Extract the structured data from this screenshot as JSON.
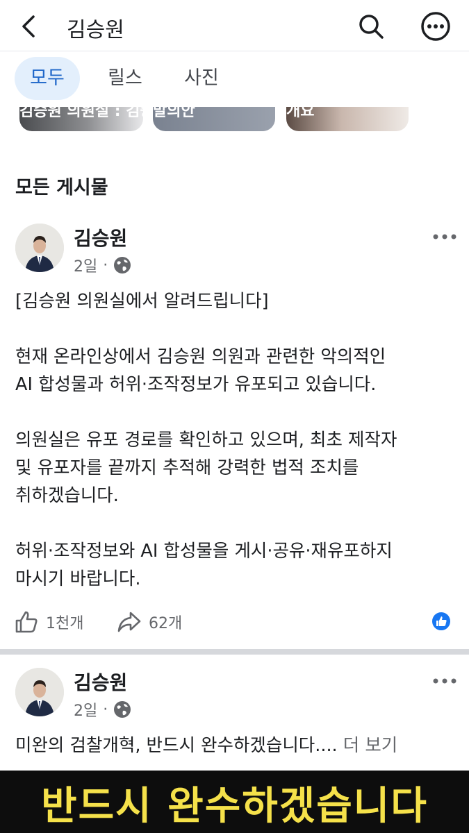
{
  "header": {
    "title": "김승원"
  },
  "tabs": [
    {
      "label": "모두",
      "active": true
    },
    {
      "label": "릴스",
      "active": false
    },
    {
      "label": "사진",
      "active": false
    }
  ],
  "thumbnails": [
    {
      "caption": "김승원 의원실 : 김승"
    },
    {
      "caption": "발의안"
    },
    {
      "caption": "개요"
    }
  ],
  "section": {
    "title": "모든 게시물"
  },
  "posts": [
    {
      "author": "김승원",
      "time": "2일",
      "separator": "·",
      "paragraphs": [
        "[김승원 의원실에서 알려드립니다]",
        "현재 온라인상에서 김승원 의원과 관련한 악의적인\nAI 합성물과 허위·조작정보가 유포되고 있습니다.",
        "의원실은 유포 경로를 확인하고 있으며, 최초 제작자\n및 유포자를 끝까지 추적해 강력한 법적 조치를\n취하겠습니다.",
        "허위·조작정보와 AI 합성물을 게시·공유·재유포하지\n마시기 바랍니다."
      ],
      "likes": "1천개",
      "shares": "62개"
    },
    {
      "author": "김승원",
      "time": "2일",
      "separator": "·",
      "text": "미완의 검찰개혁, 반드시 완수하겠습니다....",
      "more_label": "더 보기"
    }
  ],
  "video_banner": {
    "text": "반드시 완수하겠습니다"
  },
  "colors": {
    "accent": "#1877f2",
    "tab_active_bg": "#e3effc",
    "banner_text": "#f5e14a"
  }
}
